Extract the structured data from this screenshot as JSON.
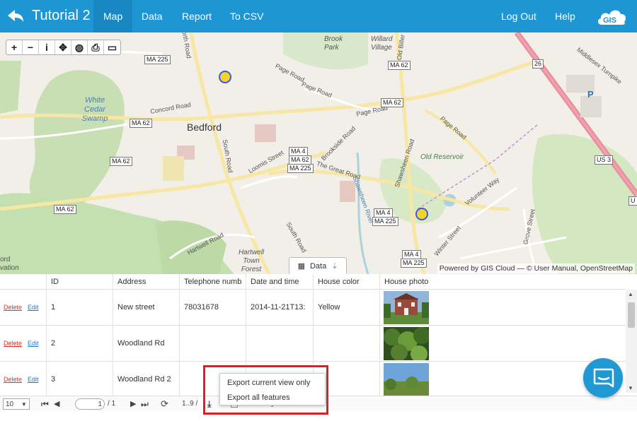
{
  "header": {
    "title": "Tutorial 2",
    "tabs": [
      {
        "label": "Map",
        "active": true
      },
      {
        "label": "Data"
      },
      {
        "label": "Report"
      },
      {
        "label": "To CSV"
      }
    ],
    "log_out": "Log Out",
    "help": "Help",
    "logo_text": "GIS",
    "accent_color": "#1e96d4"
  },
  "map": {
    "toolbar_icons": [
      "zoom-in-icon",
      "zoom-out-icon",
      "info-icon",
      "pan-icon",
      "globe-icon",
      "print-icon",
      "layers-icon"
    ],
    "toolbar_glyphs": [
      "+",
      "−",
      "i",
      "✥",
      "◍",
      "⎙",
      "▭"
    ],
    "place_labels": {
      "bedford": "Bedford",
      "white_cedar_swamp": "White Cedar Swamp",
      "old_reservoir": "Old Reservoir",
      "willard_village": "Willard Village",
      "brook_park": "Brook Park",
      "hartwell_town_forest": "Hartwell Town Forest",
      "page_road": "Page Road",
      "concord_road": "Concord Road",
      "south_road": "South Road",
      "loomis_street": "Loomis Street",
      "the_great_road": "The Great Road",
      "shawsheen_road": "Shawsheen Road",
      "volunteer_way": "Volunteer Way",
      "grove_street": "Grove Street",
      "winter_street": "Winter Street",
      "hartwell_road": "Hartwell Road",
      "brookside_road": "Brookside Road",
      "middlesex_turnpike": "Middlesex Turnpike",
      "north_road": "orth Road",
      "old_billerica": "Old Biller",
      "shawsheen_river": "Shawsheen River",
      "ord": "ord",
      "vation": "vation"
    },
    "shields": {
      "ma225_a": "MA 225",
      "ma62_a": "MA 62",
      "ma62_b": "MA 62",
      "ma62_c": "MA 62",
      "ma62_d": "MA 62",
      "ma62_e": "MA 62",
      "ma4_stack": "MA 4",
      "ma62_stack": "MA 62",
      "ma225_stack": "MA 225",
      "ma4_b": "MA 4",
      "ma225_b": "MA 225",
      "ma4_c": "MA 4",
      "ma225_c": "MA 225",
      "us3": "US 3",
      "r26": "26",
      "u": "U",
      "parking": "P"
    },
    "attribution": "Powered by GIS Cloud — © User Manual, OpenStreetMap",
    "data_tab_label": "Data",
    "marker_color": "#f2d22e"
  },
  "table": {
    "columns": [
      "",
      "ID",
      "Address",
      "Telephone numb",
      "Date and time",
      "House color",
      "House photo"
    ],
    "delete_label": "Delete",
    "edit_label": "Edit",
    "rows": [
      {
        "id": "1",
        "address": "New street",
        "telephone": "78031678",
        "datetime": "2014-11-21T13:",
        "color": "Yellow"
      },
      {
        "id": "2",
        "address": "Woodland Rd",
        "telephone": "",
        "datetime": "",
        "color": ""
      },
      {
        "id": "3",
        "address": "Woodland Rd 2",
        "telephone": "",
        "datetime": "",
        "color": ""
      }
    ]
  },
  "pager": {
    "page_size": "10",
    "current_page": "1",
    "total_pages": "/ 1",
    "range": "1..9 /",
    "show_only_selected": "Show only selected"
  },
  "export_menu": {
    "items": [
      "Export current view only",
      "Export all features"
    ]
  }
}
